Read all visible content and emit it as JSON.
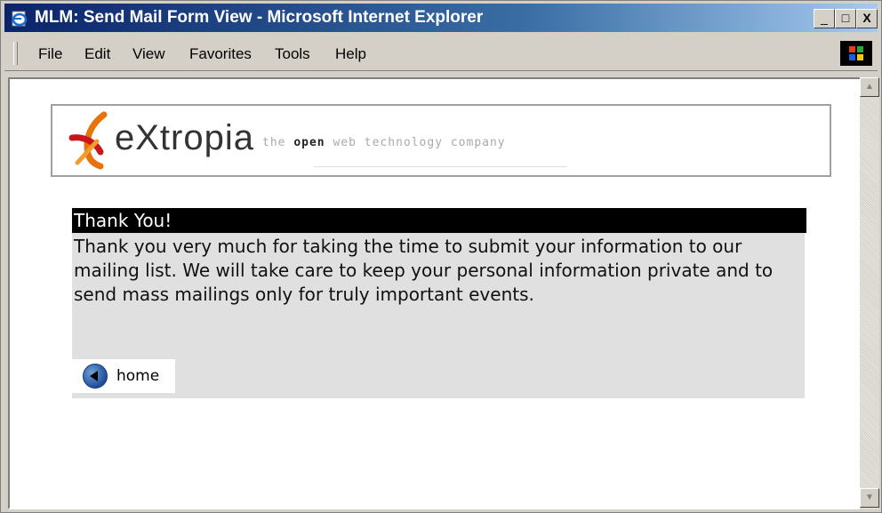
{
  "window": {
    "title": "MLM: Send Mail Form View - Microsoft Internet Explorer",
    "minimize": "_",
    "maximize": "□",
    "close": "X"
  },
  "menu": {
    "items": [
      "File",
      "Edit",
      "View",
      "Favorites",
      "Tools",
      "Help"
    ]
  },
  "banner": {
    "logo_text": "eXtropia",
    "tagline_before": "the ",
    "tagline_bold": "open",
    "tagline_after": " web technology company"
  },
  "thanks": {
    "heading": "Thank You!",
    "body": "Thank you very much for taking the time to submit your information to our mailing list. We will take care to keep your personal information private and to send mass mailings only for truly important events.",
    "home_label": "home"
  },
  "scrollbar": {
    "up": "▲",
    "down": "▼"
  },
  "colors": {
    "title_gradient_start": "#0a246a",
    "heading_bg": "#000000",
    "body_bg": "#e0e0e0",
    "logo_orange": "#e8730c",
    "logo_red": "#c8161d"
  }
}
